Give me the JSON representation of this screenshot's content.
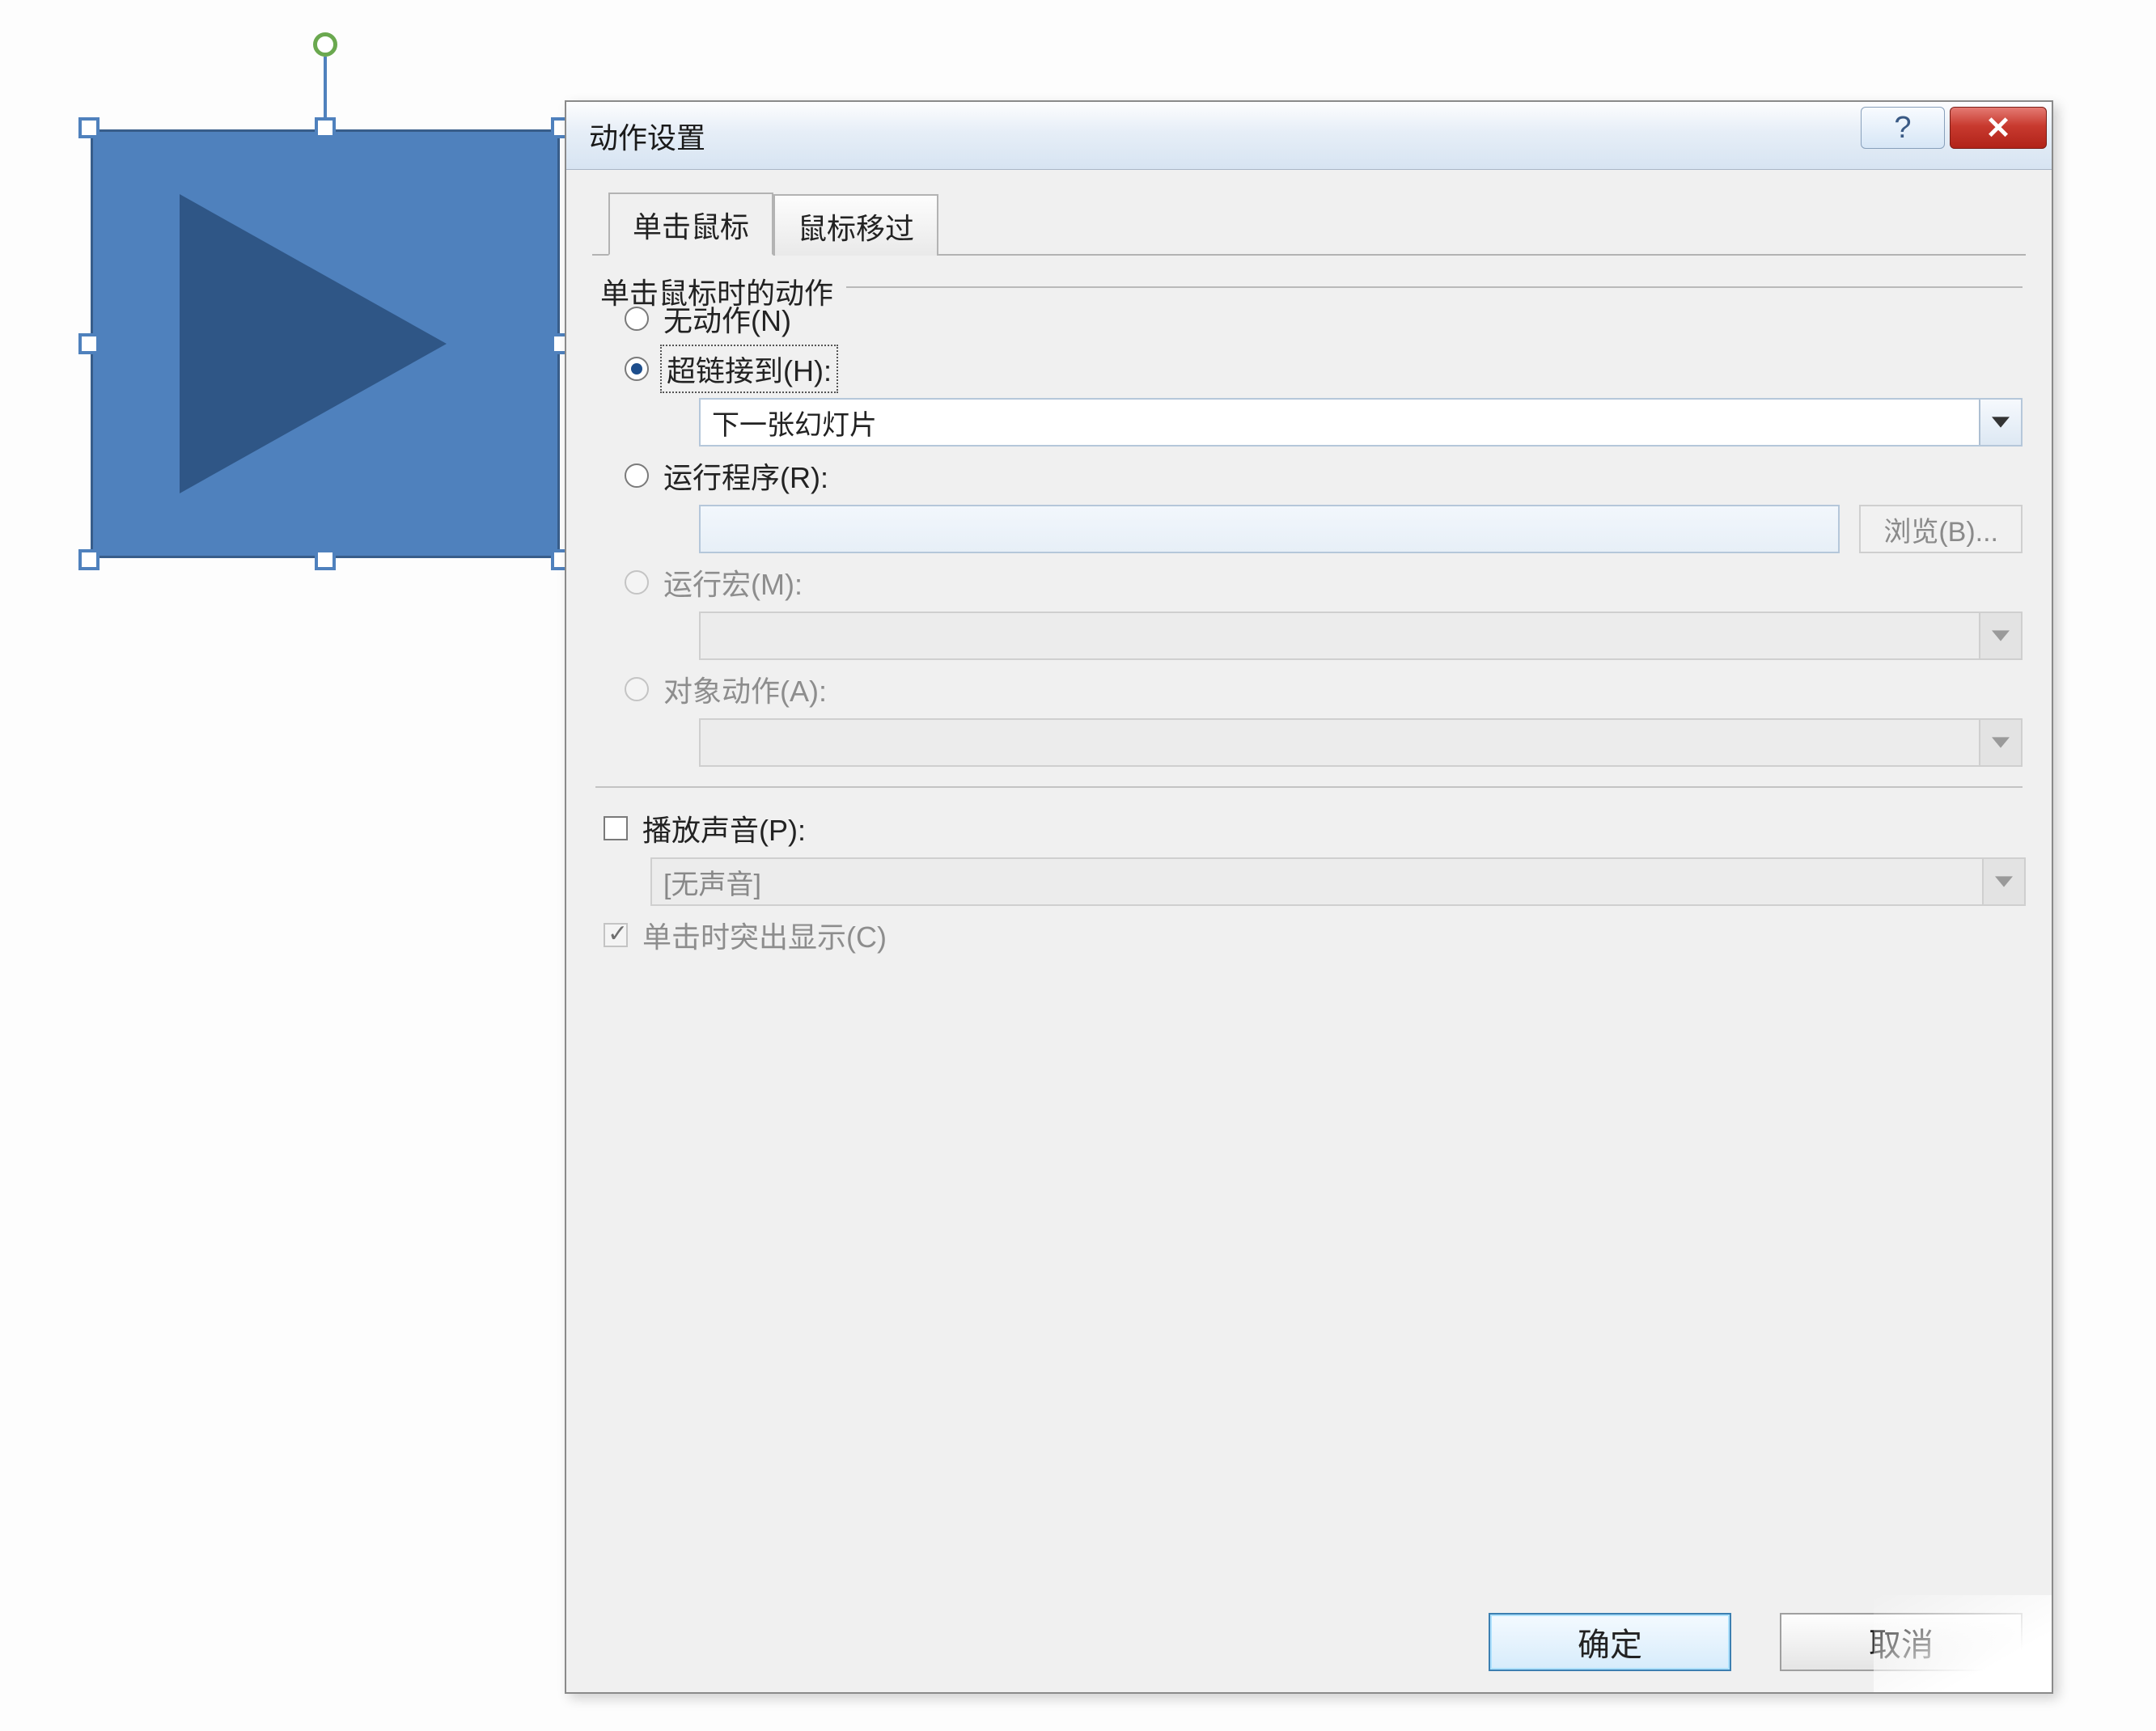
{
  "dialog": {
    "title": "动作设置",
    "help_tooltip": "帮助",
    "close_tooltip": "关闭",
    "tabs": {
      "click": "单击鼠标",
      "hover": "鼠标移过"
    },
    "group_label": "单击鼠标时的动作",
    "none_label": "无动作(N)",
    "hyperlink_label": "超链接到(H):",
    "hyperlink_value": "下一张幻灯片",
    "runprog_label": "运行程序(R):",
    "runprog_value": "",
    "browse_label": "浏览(B)...",
    "runmacro_label": "运行宏(M):",
    "runmacro_value": "",
    "objectaction_label": "对象动作(A):",
    "objectaction_value": "",
    "playsound_label": "播放声音(P):",
    "playsound_value": "[无声音]",
    "highlight_label": "单击时突出显示(C)",
    "ok": "确定",
    "cancel": "取消"
  },
  "shape": {
    "name": "action-button-forward"
  }
}
